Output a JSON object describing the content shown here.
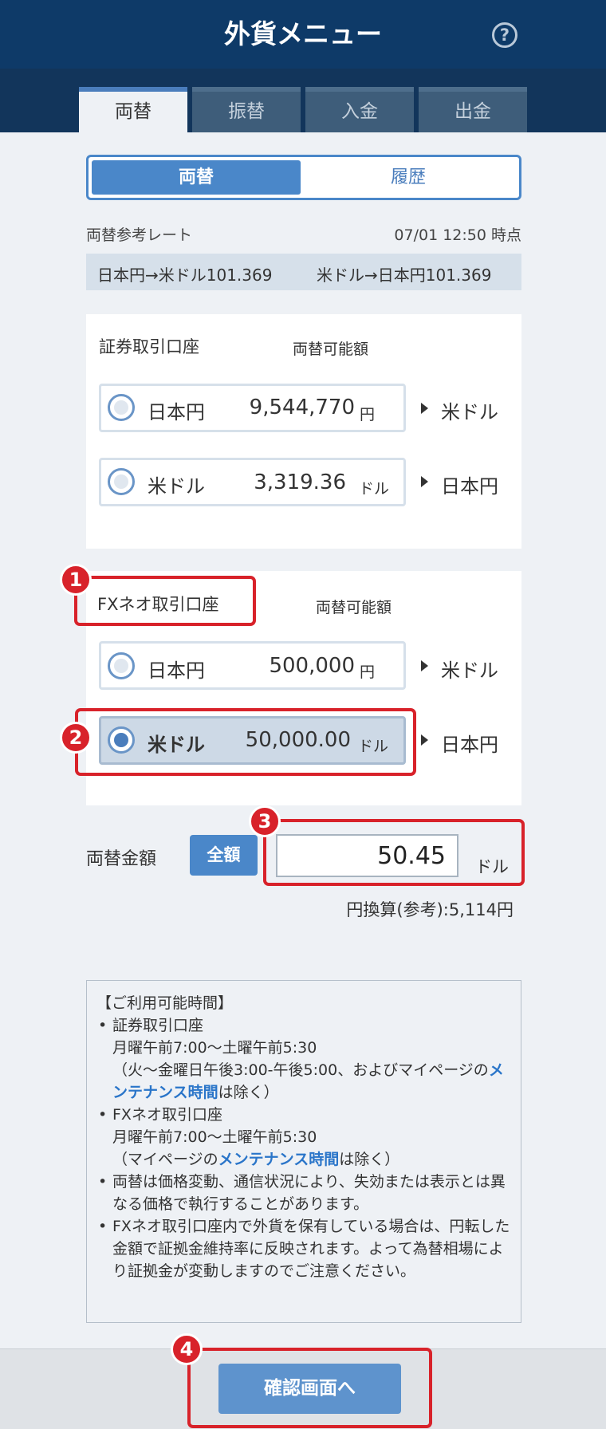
{
  "header": {
    "title": "外貨メニュー",
    "help_glyph": "?"
  },
  "tabs": [
    {
      "label": "両替",
      "active": true
    },
    {
      "label": "振替",
      "active": false
    },
    {
      "label": "入金",
      "active": false
    },
    {
      "label": "出金",
      "active": false
    }
  ],
  "segment": {
    "exchange": "両替",
    "history": "履歴"
  },
  "rate": {
    "label": "両替参考レート",
    "time": "07/01 12:50 時点",
    "jpy_to_usd": "日本円→米ドル101.369",
    "usd_to_jpy": "米ドル→日本円101.369"
  },
  "securities": {
    "account_label": "証券取引口座",
    "available_label": "両替可能額",
    "rows": [
      {
        "currency": "日本円",
        "amount": "9,544,770",
        "unit": "円",
        "target": "米ドル",
        "selected": false
      },
      {
        "currency": "米ドル",
        "amount": "3,319.36",
        "unit": "ドル",
        "target": "日本円",
        "selected": false
      }
    ]
  },
  "fx": {
    "account_label": "FXネオ取引口座",
    "available_label": "両替可能額",
    "rows": [
      {
        "currency": "日本円",
        "amount": "500,000",
        "unit": "円",
        "target": "米ドル",
        "selected": false
      },
      {
        "currency": "米ドル",
        "amount": "50,000.00",
        "unit": "ドル",
        "target": "日本円",
        "selected": true
      }
    ]
  },
  "exchange_amount": {
    "label": "両替金額",
    "all_button": "全額",
    "value": "50.45",
    "unit": "ドル",
    "yen_reference": "円換算(参考):5,114円"
  },
  "notice": {
    "heading": "【ご利用可能時間】",
    "sec_title": "証券取引口座",
    "sec_hours": "月曜午前7:00～土曜午前5:30",
    "sec_note_a": "（火～金曜日午後3:00-午後5:00、およびマイページの",
    "sec_note_link": "メンテナンス時間",
    "sec_note_b": "は除く）",
    "fx_title": "FXネオ取引口座",
    "fx_hours": "月曜午前7:00～土曜午前5:30",
    "fx_note_a": "（マイページの",
    "fx_note_link": "メンテナンス時間",
    "fx_note_b": "は除く）",
    "bullet3": "両替は価格変動、通信状況により、失効または表示とは異なる価格で執行することがあります。",
    "bullet4": "FXネオ取引口座内で外貨を保有している場合は、円転した金額で証拠金維持率に反映されます。よって為替相場により証拠金が変動しますのでご注意ください。"
  },
  "footer": {
    "confirm": "確認画面へ"
  },
  "callouts": [
    "1",
    "2",
    "3",
    "4"
  ],
  "colors": {
    "header": "#0e3a68",
    "accent": "#4a87c9",
    "callout": "#d8222a"
  }
}
